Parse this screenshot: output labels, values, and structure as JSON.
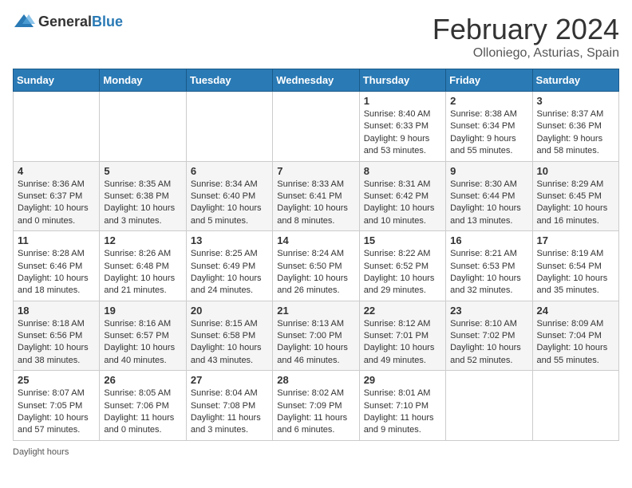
{
  "header": {
    "logo_general": "General",
    "logo_blue": "Blue",
    "title": "February 2024",
    "subtitle": "Olloniego, Asturias, Spain"
  },
  "calendar": {
    "days_of_week": [
      "Sunday",
      "Monday",
      "Tuesday",
      "Wednesday",
      "Thursday",
      "Friday",
      "Saturday"
    ],
    "weeks": [
      [
        {
          "day": "",
          "info": ""
        },
        {
          "day": "",
          "info": ""
        },
        {
          "day": "",
          "info": ""
        },
        {
          "day": "",
          "info": ""
        },
        {
          "day": "1",
          "info": "Sunrise: 8:40 AM\nSunset: 6:33 PM\nDaylight: 9 hours and 53 minutes."
        },
        {
          "day": "2",
          "info": "Sunrise: 8:38 AM\nSunset: 6:34 PM\nDaylight: 9 hours and 55 minutes."
        },
        {
          "day": "3",
          "info": "Sunrise: 8:37 AM\nSunset: 6:36 PM\nDaylight: 9 hours and 58 minutes."
        }
      ],
      [
        {
          "day": "4",
          "info": "Sunrise: 8:36 AM\nSunset: 6:37 PM\nDaylight: 10 hours and 0 minutes."
        },
        {
          "day": "5",
          "info": "Sunrise: 8:35 AM\nSunset: 6:38 PM\nDaylight: 10 hours and 3 minutes."
        },
        {
          "day": "6",
          "info": "Sunrise: 8:34 AM\nSunset: 6:40 PM\nDaylight: 10 hours and 5 minutes."
        },
        {
          "day": "7",
          "info": "Sunrise: 8:33 AM\nSunset: 6:41 PM\nDaylight: 10 hours and 8 minutes."
        },
        {
          "day": "8",
          "info": "Sunrise: 8:31 AM\nSunset: 6:42 PM\nDaylight: 10 hours and 10 minutes."
        },
        {
          "day": "9",
          "info": "Sunrise: 8:30 AM\nSunset: 6:44 PM\nDaylight: 10 hours and 13 minutes."
        },
        {
          "day": "10",
          "info": "Sunrise: 8:29 AM\nSunset: 6:45 PM\nDaylight: 10 hours and 16 minutes."
        }
      ],
      [
        {
          "day": "11",
          "info": "Sunrise: 8:28 AM\nSunset: 6:46 PM\nDaylight: 10 hours and 18 minutes."
        },
        {
          "day": "12",
          "info": "Sunrise: 8:26 AM\nSunset: 6:48 PM\nDaylight: 10 hours and 21 minutes."
        },
        {
          "day": "13",
          "info": "Sunrise: 8:25 AM\nSunset: 6:49 PM\nDaylight: 10 hours and 24 minutes."
        },
        {
          "day": "14",
          "info": "Sunrise: 8:24 AM\nSunset: 6:50 PM\nDaylight: 10 hours and 26 minutes."
        },
        {
          "day": "15",
          "info": "Sunrise: 8:22 AM\nSunset: 6:52 PM\nDaylight: 10 hours and 29 minutes."
        },
        {
          "day": "16",
          "info": "Sunrise: 8:21 AM\nSunset: 6:53 PM\nDaylight: 10 hours and 32 minutes."
        },
        {
          "day": "17",
          "info": "Sunrise: 8:19 AM\nSunset: 6:54 PM\nDaylight: 10 hours and 35 minutes."
        }
      ],
      [
        {
          "day": "18",
          "info": "Sunrise: 8:18 AM\nSunset: 6:56 PM\nDaylight: 10 hours and 38 minutes."
        },
        {
          "day": "19",
          "info": "Sunrise: 8:16 AM\nSunset: 6:57 PM\nDaylight: 10 hours and 40 minutes."
        },
        {
          "day": "20",
          "info": "Sunrise: 8:15 AM\nSunset: 6:58 PM\nDaylight: 10 hours and 43 minutes."
        },
        {
          "day": "21",
          "info": "Sunrise: 8:13 AM\nSunset: 7:00 PM\nDaylight: 10 hours and 46 minutes."
        },
        {
          "day": "22",
          "info": "Sunrise: 8:12 AM\nSunset: 7:01 PM\nDaylight: 10 hours and 49 minutes."
        },
        {
          "day": "23",
          "info": "Sunrise: 8:10 AM\nSunset: 7:02 PM\nDaylight: 10 hours and 52 minutes."
        },
        {
          "day": "24",
          "info": "Sunrise: 8:09 AM\nSunset: 7:04 PM\nDaylight: 10 hours and 55 minutes."
        }
      ],
      [
        {
          "day": "25",
          "info": "Sunrise: 8:07 AM\nSunset: 7:05 PM\nDaylight: 10 hours and 57 minutes."
        },
        {
          "day": "26",
          "info": "Sunrise: 8:05 AM\nSunset: 7:06 PM\nDaylight: 11 hours and 0 minutes."
        },
        {
          "day": "27",
          "info": "Sunrise: 8:04 AM\nSunset: 7:08 PM\nDaylight: 11 hours and 3 minutes."
        },
        {
          "day": "28",
          "info": "Sunrise: 8:02 AM\nSunset: 7:09 PM\nDaylight: 11 hours and 6 minutes."
        },
        {
          "day": "29",
          "info": "Sunrise: 8:01 AM\nSunset: 7:10 PM\nDaylight: 11 hours and 9 minutes."
        },
        {
          "day": "",
          "info": ""
        },
        {
          "day": "",
          "info": ""
        }
      ]
    ]
  },
  "footer": {
    "daylight_label": "Daylight hours"
  }
}
